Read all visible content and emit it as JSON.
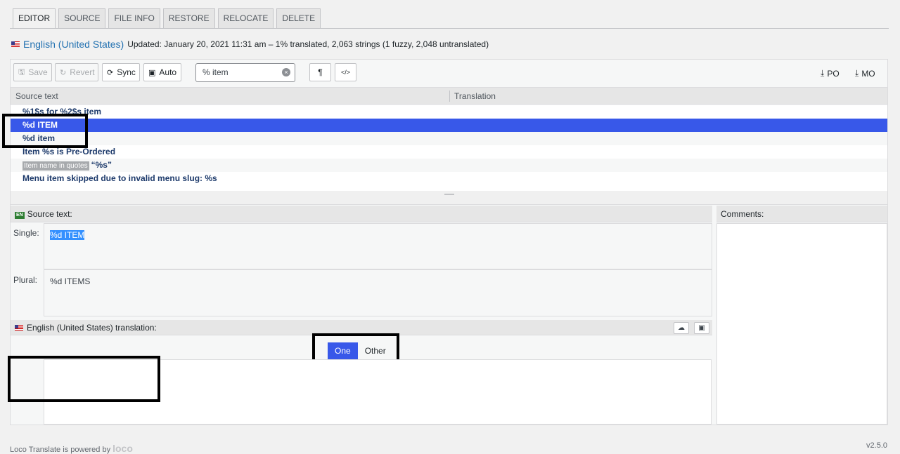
{
  "tabs": [
    "EDITOR",
    "SOURCE",
    "FILE INFO",
    "RESTORE",
    "RELOCATE",
    "DELETE"
  ],
  "locale": {
    "name": "English (United States)",
    "meta": "Updated: January 20, 2021 11:31 am – 1% translated, 2,063 strings (1 fuzzy, 2,048 untranslated)"
  },
  "toolbar": {
    "save": "Save",
    "revert": "Revert",
    "sync": "Sync",
    "auto": "Auto",
    "search_value": "% item",
    "pilcrow": "¶",
    "code": "</>",
    "po": "PO",
    "mo": "MO"
  },
  "grid": {
    "source_header": "Source text",
    "translation_header": "Translation",
    "rows": [
      {
        "text": "%1$s for %2$s item",
        "context": ""
      },
      {
        "text": "%d ITEM",
        "context": ""
      },
      {
        "text": "%d item",
        "context": ""
      },
      {
        "text": "Item %s is Pre-Ordered",
        "context": ""
      },
      {
        "text": "“%s”",
        "context": "Item name in quotes"
      },
      {
        "text": "Menu item skipped due to invalid menu slug: %s",
        "context": ""
      }
    ]
  },
  "source": {
    "badge": "EN",
    "heading": "Source text:",
    "single_label": "Single:",
    "single_text": "%d ITEM",
    "plural_label": "Plural:",
    "plural_text": "%d ITEMS"
  },
  "translation": {
    "heading": "English (United States) translation:",
    "plural_tabs": [
      "One",
      "Other"
    ]
  },
  "comments": {
    "heading": "Comments:"
  },
  "footer": {
    "powered": "Loco Translate is powered by",
    "logo": "loco",
    "version": "v2.5.0"
  },
  "colors": {
    "selected_row": "#3858e9",
    "link": "#2271b1"
  }
}
